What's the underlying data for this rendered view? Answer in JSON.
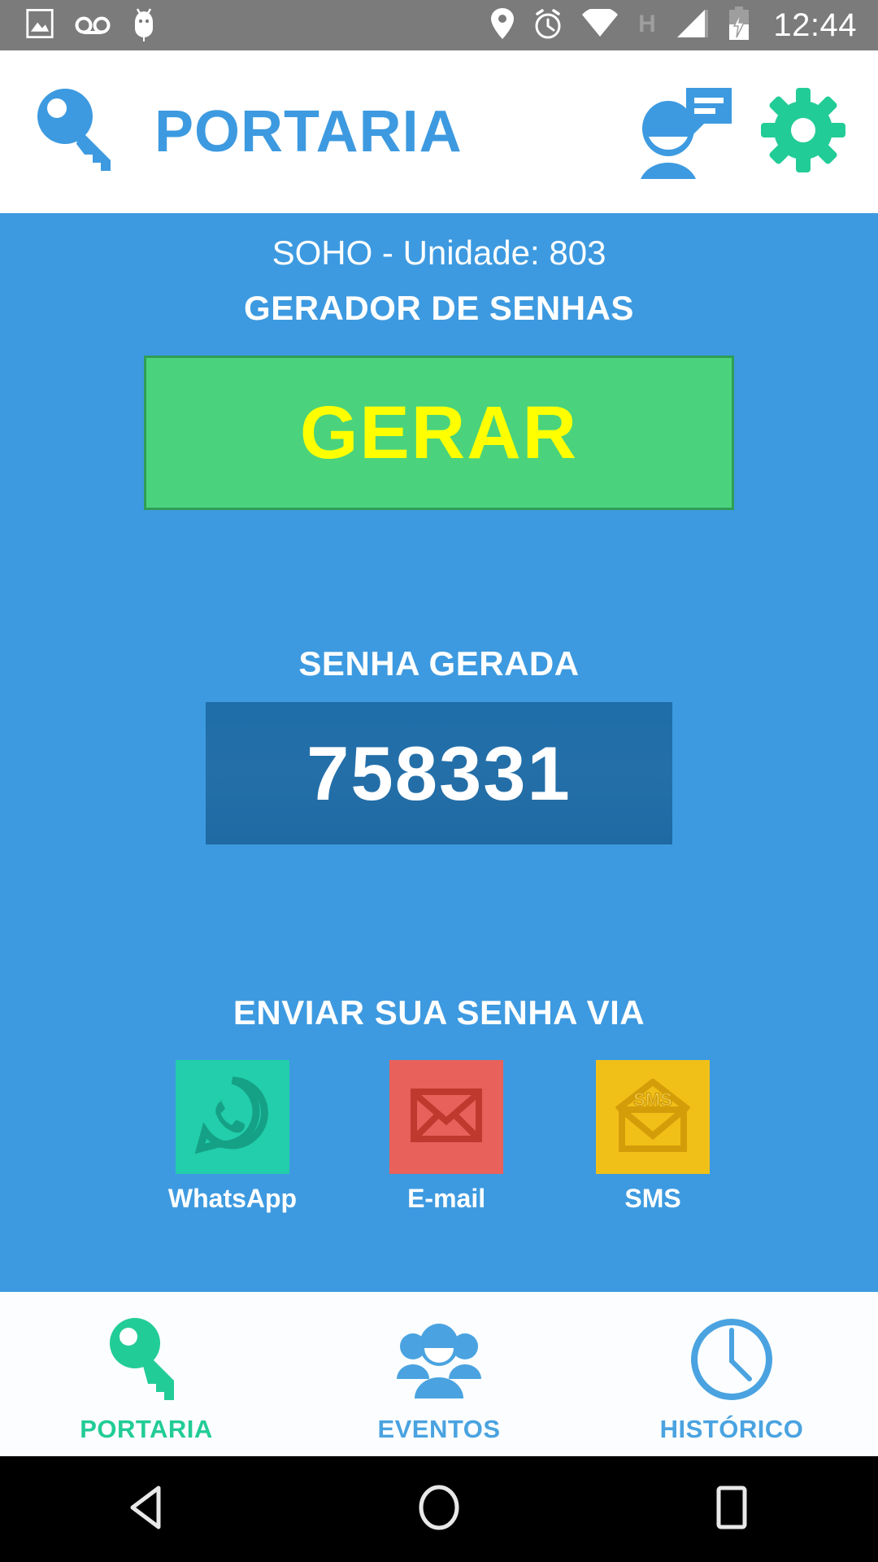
{
  "statusbar": {
    "time": "12:44",
    "network_label": "H",
    "left_icons": [
      "image-icon",
      "voicemail-icon",
      "android-bug-icon"
    ],
    "right_icons": [
      "location-icon",
      "alarm-icon",
      "wifi-icon",
      "signal-icon",
      "battery-charging-icon"
    ]
  },
  "appbar": {
    "logo_icon": "key-icon",
    "title": "PORTARIA",
    "profile_icon": "user-message-icon",
    "settings_icon": "gear-icon",
    "title_color": "#3d9ae0",
    "settings_color": "#22cc96"
  },
  "content": {
    "unit": "SOHO - Unidade: 803",
    "generator_title": "GERADOR DE SENHAS",
    "generate_button": "GERAR",
    "generate_button_color": "#4ad37c",
    "generate_label_color": "#ffff00",
    "password_label": "SENHA GERADA",
    "password_value": "758331",
    "password_box_color": "#216ea8",
    "send_label": "ENVIAR SUA SENHA VIA",
    "share_options": [
      {
        "name": "WhatsApp",
        "icon": "whatsapp-icon",
        "tile_color": "#22ceab",
        "glyph_color": "#15a186"
      },
      {
        "name": "E-mail",
        "icon": "envelope-closed-icon",
        "tile_color": "#e8615a",
        "glyph_color": "#c0392f"
      },
      {
        "name": "SMS",
        "icon": "envelope-open-sms-icon",
        "tile_color": "#f1c018",
        "glyph_color": "#d39d0a",
        "glyph_text": "SMS"
      }
    ],
    "background_color": "#3d9ae0"
  },
  "tabbar": {
    "tabs": [
      {
        "label": "PORTARIA",
        "icon": "key-icon",
        "active": true,
        "color": "#22cc96"
      },
      {
        "label": "EVENTOS",
        "icon": "people-group-icon",
        "active": false,
        "color": "#4aa3e0"
      },
      {
        "label": "HISTÓRICO",
        "icon": "clock-icon",
        "active": false,
        "color": "#4aa3e0"
      }
    ]
  },
  "navbar": {
    "back": "back-triangle-icon",
    "home": "home-circle-icon",
    "recents": "recents-square-icon"
  }
}
